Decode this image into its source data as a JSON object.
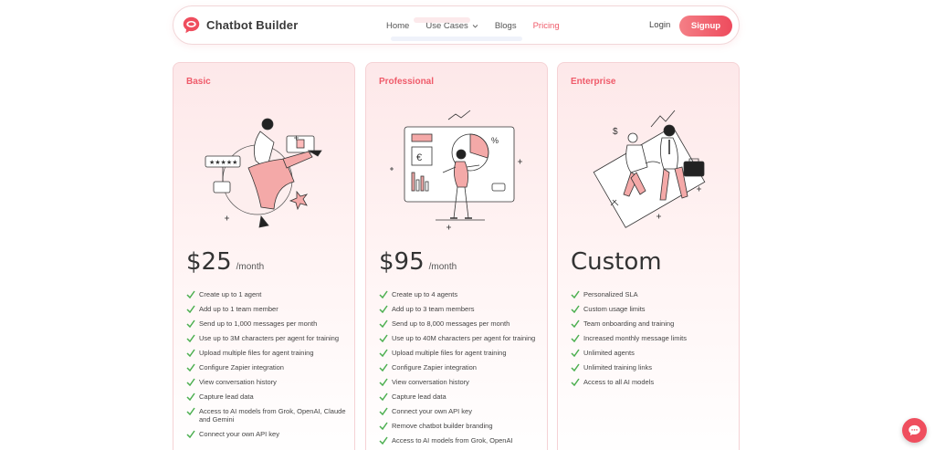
{
  "brand": {
    "name": "Chatbot Builder"
  },
  "nav": {
    "items": [
      {
        "label": "Home",
        "active": false
      },
      {
        "label": "Use Cases",
        "active": false,
        "has_dropdown": true
      },
      {
        "label": "Blogs",
        "active": false
      },
      {
        "label": "Pricing",
        "active": true
      }
    ],
    "login_label": "Login",
    "signup_label": "Signup"
  },
  "colors": {
    "accent": "#ef5b6a",
    "check": "#4caf50",
    "card_bg": "#fde8e9"
  },
  "plans": [
    {
      "name": "Basic",
      "price": "$25",
      "period": "/month",
      "illustration": "person-jumping-with-rating-icon",
      "features": [
        "Create up to 1 agent",
        "Add up to 1 team member",
        "Send up to 1,000 messages per month",
        "Use up to 3M characters per agent for training",
        "Upload multiple files for agent training",
        "Configure Zapier integration",
        "View conversation history",
        "Capture lead data",
        "Access to AI models from Grok, OpenAI, Claude and Gemini",
        "Connect your own API key"
      ]
    },
    {
      "name": "Professional",
      "price": "$95",
      "period": "/month",
      "illustration": "person-presenting-dashboard-icon",
      "features": [
        "Create up to 4 agents",
        "Add up to 3 team members",
        "Send up to 8,000 messages per month",
        "Use up to 40M characters per agent for training",
        "Upload multiple files for agent training",
        "Configure Zapier integration",
        "View conversation history",
        "Capture lead data",
        "Connect your own API key",
        "Remove chatbot builder branding",
        "Access to AI models from Grok, OpenAI"
      ]
    },
    {
      "name": "Enterprise",
      "price": "Custom",
      "period": "",
      "illustration": "business-handshake-icon",
      "features": [
        "Personalized SLA",
        "Custom usage limits",
        "Team onboarding and training",
        "Increased monthly message limits",
        "Unlimited agents",
        "Unlimited training links",
        "Access to all AI models"
      ]
    }
  ]
}
